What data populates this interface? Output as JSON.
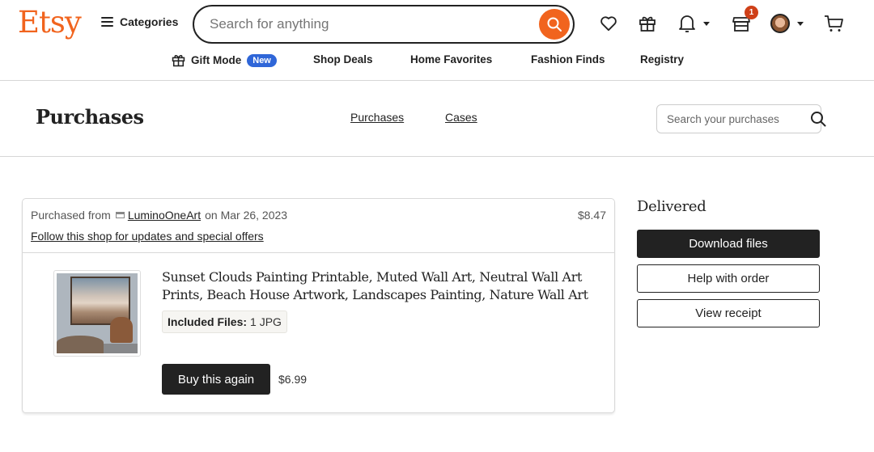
{
  "header": {
    "logo": "Etsy",
    "categories_label": "Categories",
    "search_placeholder": "Search for anything",
    "cart_badge_count": "1",
    "accent_color": "#f1641e"
  },
  "subnav": {
    "items": [
      {
        "label": "Gift Mode",
        "badge": "New"
      },
      {
        "label": "Shop Deals"
      },
      {
        "label": "Home Favorites"
      },
      {
        "label": "Fashion Finds"
      },
      {
        "label": "Registry"
      }
    ]
  },
  "page": {
    "title": "Purchases",
    "tabs": [
      {
        "label": "Purchases"
      },
      {
        "label": "Cases"
      }
    ],
    "search_placeholder": "Search your purchases"
  },
  "order": {
    "purchased_from_prefix": "Purchased from",
    "shop_name": "LuminoOneArt",
    "date_text": "on Mar 26, 2023",
    "total": "$8.47",
    "follow_text": "Follow this shop for updates and special offers",
    "item": {
      "title": "Sunset Clouds Painting Printable, Muted Wall Art, Neutral Wall Art Prints, Beach House Artwork, Landscapes Painting, Nature Wall Art",
      "files_label": "Included Files:",
      "files_value": "1 JPG",
      "buy_again_label": "Buy this again",
      "price": "$6.99"
    },
    "status": "Delivered",
    "actions": {
      "download": "Download files",
      "help": "Help with order",
      "receipt": "View receipt"
    }
  }
}
